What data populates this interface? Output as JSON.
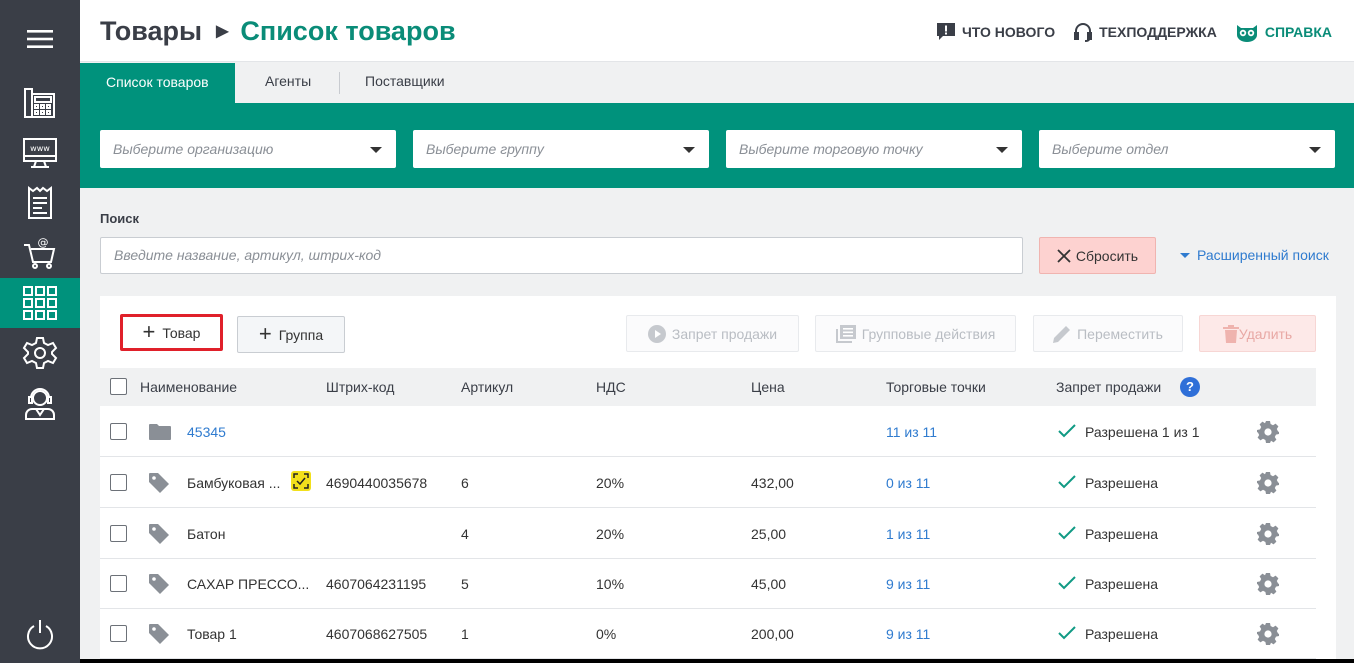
{
  "sidebar": {
    "items": [
      {
        "name": "menu-icon"
      },
      {
        "name": "cash-register-icon"
      },
      {
        "name": "www-monitor-icon"
      },
      {
        "name": "receipt-icon"
      },
      {
        "name": "shopping-cart-at-icon"
      },
      {
        "name": "grid-apps-icon",
        "active": true
      },
      {
        "name": "gear-icon"
      },
      {
        "name": "operator-headset-icon"
      },
      {
        "name": "power-icon"
      }
    ]
  },
  "header": {
    "breadcrumb_root": "Товары",
    "breadcrumb_current": "Список товаров",
    "whats_new": "ЧТО НОВОГО",
    "support": "ТЕХПОДДЕРЖКА",
    "help": "СПРАВКА"
  },
  "tabs": [
    "Список товаров",
    "Агенты",
    "Поставщики"
  ],
  "filters": {
    "organization_placeholder": "Выберите организацию",
    "group_placeholder": "Выберите группу",
    "outlet_placeholder": "Выберите торговую точку",
    "department_placeholder": "Выберите отдел"
  },
  "search": {
    "label": "Поиск",
    "placeholder": "Введите название, артикул, штрих-код",
    "reset": "Сбросить",
    "advanced": "Расширенный поиск"
  },
  "toolbar": {
    "add_product": "Товар",
    "add_group": "Группа",
    "ban_sale": "Запрет продажи",
    "group_actions": "Групповые действия",
    "move": "Переместить",
    "delete": "Удалить"
  },
  "table": {
    "columns": [
      "Наименование",
      "Штрих-код",
      "Артикул",
      "НДС",
      "Цена",
      "Торговые точки",
      "Запрет продажи"
    ],
    "rows": [
      {
        "type": "folder",
        "name": "45345",
        "barcode": "",
        "article": "",
        "vat": "",
        "price": "",
        "outlets": "11 из 11",
        "sale": "Разрешена 1 из 1"
      },
      {
        "type": "product",
        "name": "Бамбуковая ...",
        "marked": true,
        "barcode": "4690440035678",
        "article": "6",
        "vat": "20%",
        "price": "432,00",
        "outlets": "0 из 11",
        "sale": "Разрешена"
      },
      {
        "type": "product",
        "name": "Батон",
        "barcode": "",
        "article": "4",
        "vat": "20%",
        "price": "25,00",
        "outlets": "1 из 11",
        "sale": "Разрешена"
      },
      {
        "type": "product",
        "name": "САХАР ПРЕССО...",
        "barcode": "4607064231195",
        "article": "5",
        "vat": "10%",
        "price": "45,00",
        "outlets": "9 из 11",
        "sale": "Разрешена"
      },
      {
        "type": "product",
        "name": "Товар 1",
        "barcode": "4607068627505",
        "article": "1",
        "vat": "0%",
        "price": "200,00",
        "outlets": "9 из 11",
        "sale": "Разрешена"
      }
    ]
  },
  "colors": {
    "accent": "#00927c",
    "sidebar": "#3a3e47",
    "link": "#2f7bcf",
    "highlight": "#e0202a"
  }
}
